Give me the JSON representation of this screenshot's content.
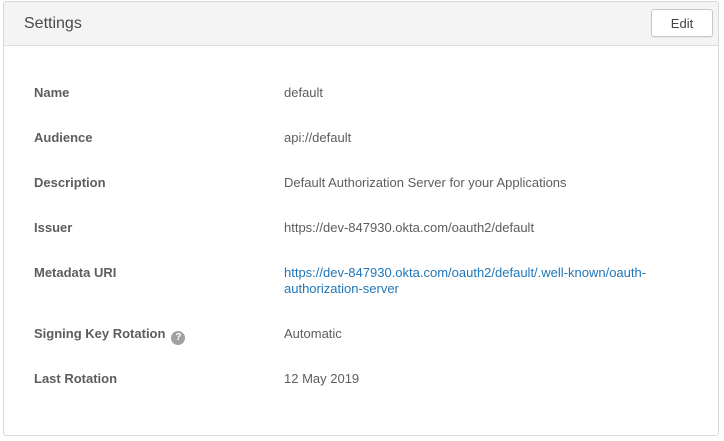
{
  "panel": {
    "title": "Settings",
    "edit_label": "Edit"
  },
  "fields": {
    "name": {
      "label": "Name",
      "value": "default"
    },
    "audience": {
      "label": "Audience",
      "value": "api://default"
    },
    "description": {
      "label": "Description",
      "value": "Default Authorization Server for your Applications"
    },
    "issuer": {
      "label": "Issuer",
      "value": "https://dev-847930.okta.com/oauth2/default"
    },
    "metadata_uri": {
      "label": "Metadata URI",
      "value": "https://dev-847930.okta.com/oauth2/default/.well-known/oauth-authorization-server"
    },
    "signing_key_rotation": {
      "label": "Signing Key Rotation",
      "help_glyph": "?",
      "value": "Automatic"
    },
    "last_rotation": {
      "label": "Last Rotation",
      "value": "12 May 2019"
    }
  },
  "colors": {
    "header_bg": "#f4f4f4",
    "link": "#1f76b9",
    "text": "#5d5d5d",
    "help_icon": "#a0a0a0"
  },
  "icons": {
    "help": "question-circle-icon"
  }
}
